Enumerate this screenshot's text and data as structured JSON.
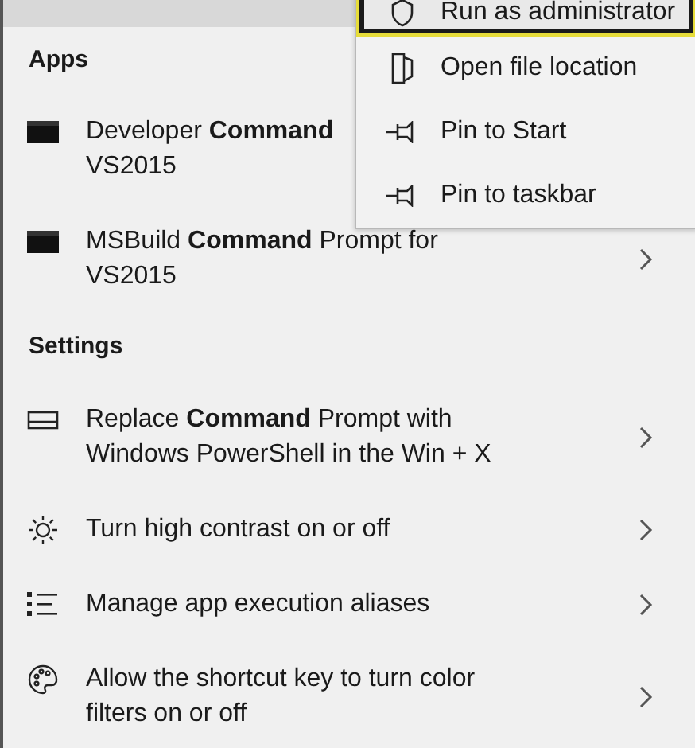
{
  "sections": [
    {
      "title": "Apps",
      "items": [
        {
          "kind": "console",
          "lines": [
            "Developer **Command**",
            "VS2015"
          ]
        },
        {
          "kind": "console",
          "lines": [
            "MSBuild **Command** Prompt for",
            "VS2015"
          ]
        }
      ]
    },
    {
      "title": "Settings",
      "items": [
        {
          "kind": "keyboard",
          "lines": [
            "Replace **Command** Prompt with",
            "Windows PowerShell in the Win + X"
          ]
        },
        {
          "kind": "sun",
          "lines": [
            "Turn high contrast on or off"
          ]
        },
        {
          "kind": "list",
          "lines": [
            "Manage app execution aliases"
          ]
        },
        {
          "kind": "palette",
          "lines": [
            "Allow the shortcut key to turn color",
            "filters on or off"
          ]
        }
      ]
    }
  ],
  "context_menu": {
    "items": [
      {
        "kind": "shield",
        "label": "Run as administrator",
        "selected": true
      },
      {
        "kind": "folder",
        "label": "Open file location",
        "selected": false
      },
      {
        "kind": "pin",
        "label": "Pin to Start",
        "selected": false
      },
      {
        "kind": "pin",
        "label": "Pin to taskbar",
        "selected": false
      }
    ]
  }
}
